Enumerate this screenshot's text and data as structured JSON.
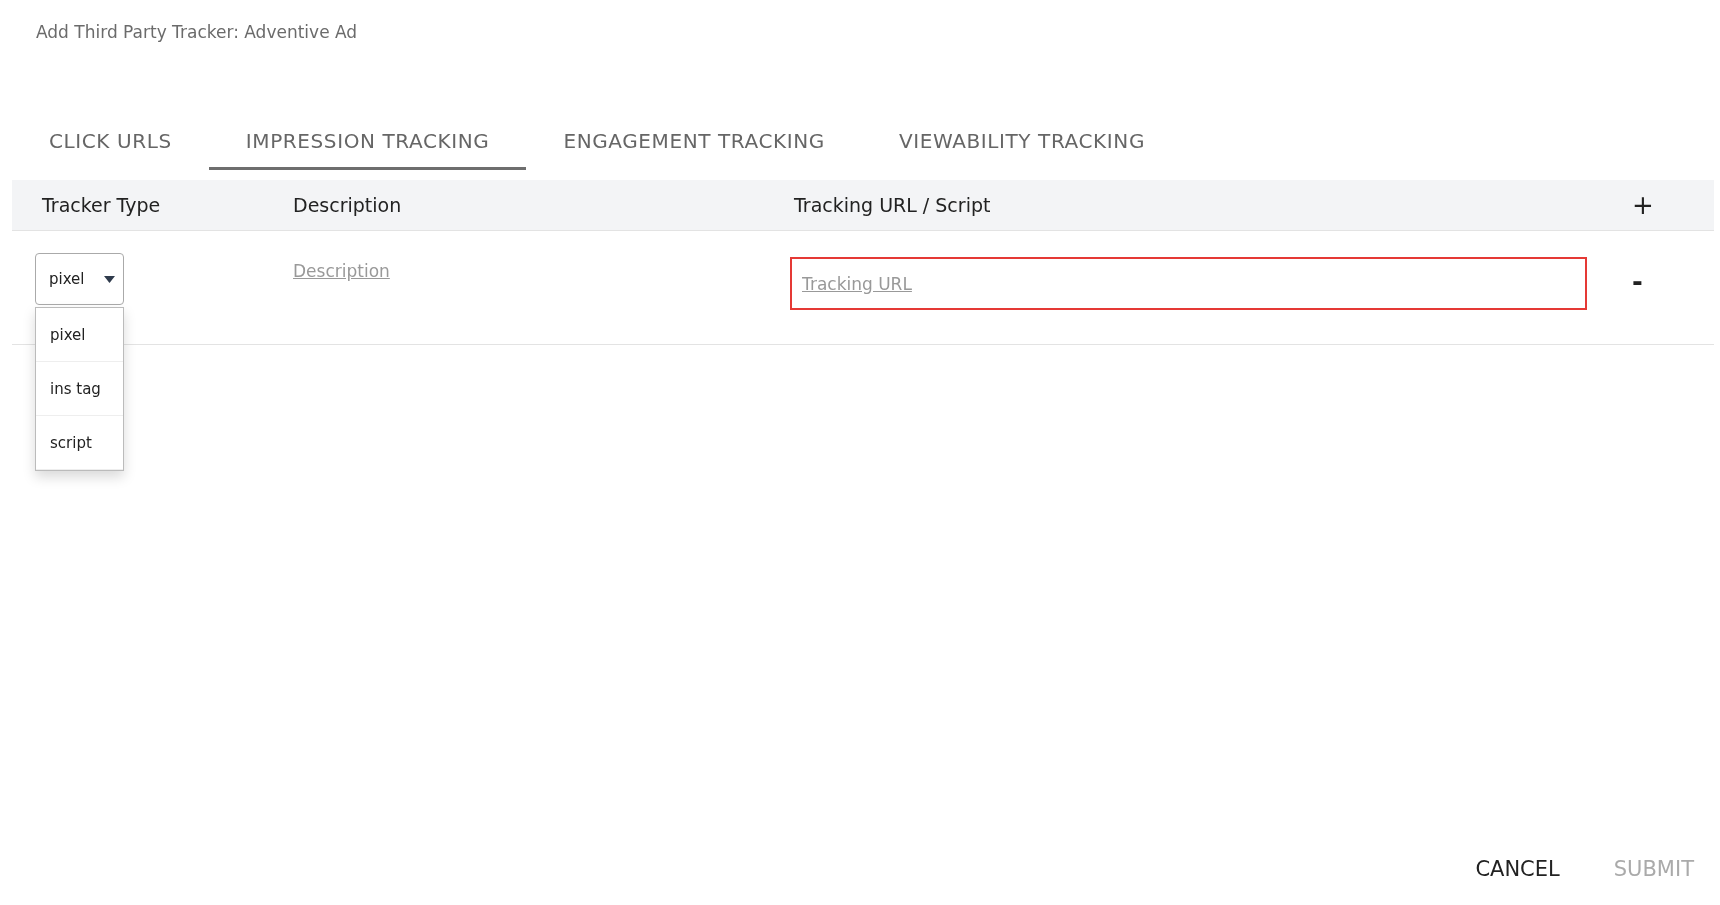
{
  "dialog": {
    "title": "Add Third Party Tracker: Adventive Ad"
  },
  "tabs": [
    {
      "label": "CLICK URLS",
      "selected": false
    },
    {
      "label": "IMPRESSION TRACKING",
      "selected": true
    },
    {
      "label": "ENGAGEMENT TRACKING",
      "selected": false
    },
    {
      "label": "VIEWABILITY TRACKING",
      "selected": false
    }
  ],
  "table": {
    "columns": [
      "Tracker Type",
      "Description",
      "Tracking URL / Script"
    ],
    "add_button": "+",
    "rows": [
      {
        "tracker_type": {
          "value": "pixel",
          "expanded": true,
          "options": [
            "pixel",
            "ins tag",
            "script"
          ]
        },
        "description": {
          "placeholder": "Description"
        },
        "tracking_url": {
          "placeholder": "Tracking URL",
          "error": true
        },
        "remove_button": "-"
      }
    ]
  },
  "buttons": [
    {
      "label": "CANCEL",
      "disabled": false
    },
    {
      "label": "SUBMIT",
      "disabled": true
    }
  ]
}
